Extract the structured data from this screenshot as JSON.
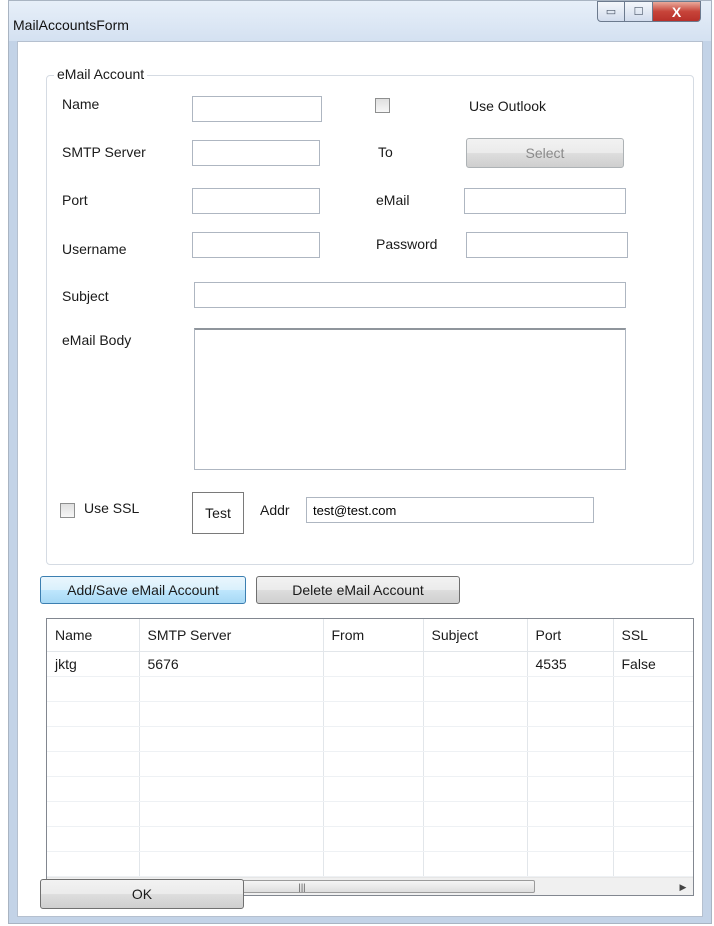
{
  "window": {
    "title": "MailAccountsForm",
    "min_glyph": "▭",
    "max_glyph": "☐",
    "close_glyph": "X"
  },
  "group": {
    "legend": "eMail Account"
  },
  "fields": {
    "name_label": "Name",
    "name_value": "",
    "smtp_label": "SMTP Server",
    "smtp_value": "",
    "port_label": "Port",
    "port_value": "",
    "username_label": "Username",
    "username_value": "",
    "use_outlook_label": "Use Outlook",
    "use_outlook_checked": false,
    "to_label": "To",
    "select_button": "Select",
    "email_label": "eMail",
    "email_value": "",
    "password_label": "Password",
    "password_value": "",
    "subject_label": "Subject",
    "subject_value": "",
    "body_label": "eMail Body",
    "body_value": "",
    "use_ssl_label": "Use SSL",
    "use_ssl_checked": false,
    "test_button": "Test",
    "addr_label": "Addr",
    "addr_value": "test@test.com"
  },
  "actions": {
    "add_save": "Add/Save eMail Account",
    "delete": "Delete eMail Account",
    "ok": "OK"
  },
  "table": {
    "columns": [
      "Name",
      "SMTP Server",
      "From",
      "Subject",
      "Port",
      "SSL"
    ],
    "rows": [
      [
        "jktg",
        "5676",
        "",
        "",
        "4535",
        "False"
      ]
    ],
    "empty_rows": 8
  },
  "scrollbar": {
    "left_arrow": "◀",
    "right_arrow": "▶",
    "thumb_grip": "|||"
  }
}
